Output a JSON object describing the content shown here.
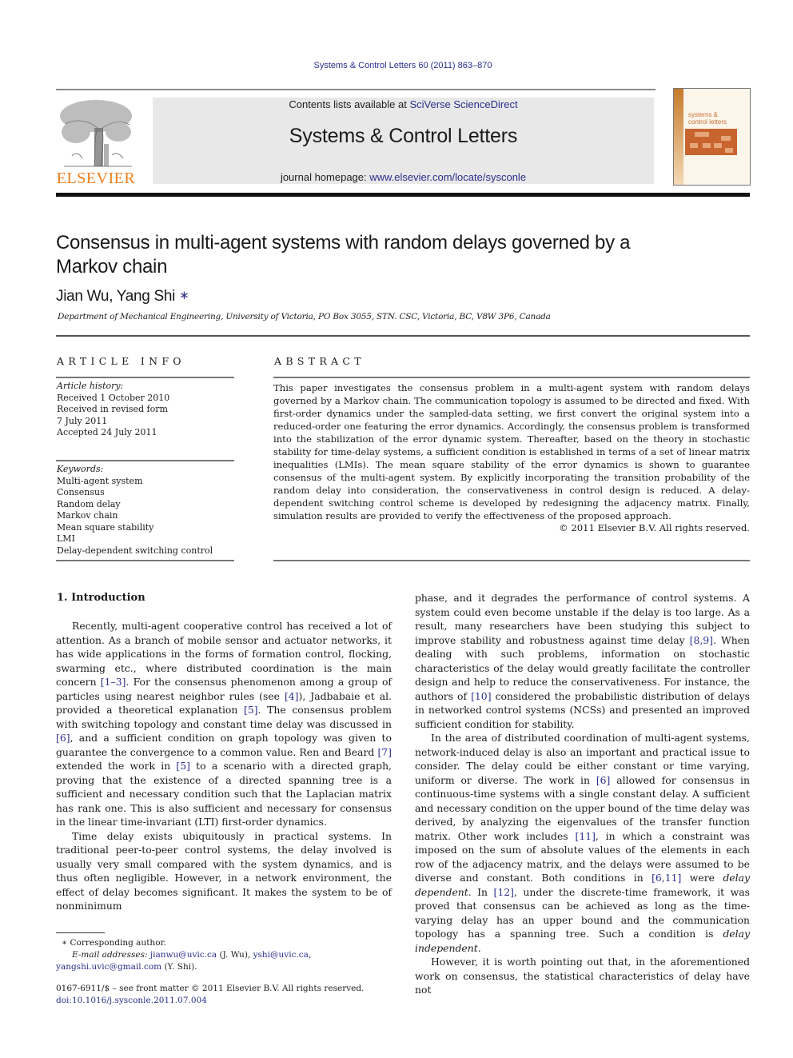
{
  "header": {
    "citation": "Systems & Control Letters 60 (2011) 863–870",
    "contents_prefix": "Contents lists available at ",
    "contents_link": "SciVerse ScienceDirect",
    "journal_name": "Systems & Control Letters",
    "homepage_prefix": "journal homepage: ",
    "homepage_link": "www.elsevier.com/locate/sysconle",
    "publisher_logo": "ELSEVIER",
    "cover_title_line1": "systems &",
    "cover_title_line2": "control letters",
    "colors": {
      "link": "#2b2f8c",
      "elsevier_orange": "#f07e1b",
      "banner_bg": "#e8e8e8"
    }
  },
  "article": {
    "title": "Consensus in multi-agent systems with random delays governed by a Markov chain",
    "authors": "Jian Wu, Yang Shi",
    "author_mark": "∗",
    "affiliation": "Department of Mechanical Engineering, University of Victoria, PO Box 3055, STN. CSC, Victoria, BC, V8W 3P6, Canada"
  },
  "article_info": {
    "heading": "ARTICLE INFO",
    "history_label": "Article history:",
    "history": [
      "Received 1 October 2010",
      "Received in revised form",
      "7 July 2011",
      "Accepted 24 July 2011"
    ],
    "keywords_label": "Keywords:",
    "keywords": [
      "Multi-agent system",
      "Consensus",
      "Random delay",
      "Markov chain",
      "Mean square stability",
      "LMI",
      "Delay-dependent switching control"
    ]
  },
  "abstract": {
    "heading": "ABSTRACT",
    "text": "This paper investigates the consensus problem in a multi-agent system with random delays governed by a Markov chain. The communication topology is assumed to be directed and fixed. With first-order dynamics under the sampled-data setting, we first convert the original system into a reduced-order one featuring the error dynamics. Accordingly, the consensus problem is transformed into the stabilization of the error dynamic system. Thereafter, based on the theory in stochastic stability for time-delay systems, a sufficient condition is established in terms of a set of linear matrix inequalities (LMIs). The mean square stability of the error dynamics is shown to guarantee consensus of the multi-agent system. By explicitly incorporating the transition probability of the random delay into consideration, the conservativeness in control design is reduced. A delay-dependent switching control scheme is developed by redesigning the adjacency matrix. Finally, simulation results are provided to verify the effectiveness of the proposed approach.",
    "copyright": "© 2011 Elsevier B.V. All rights reserved."
  },
  "introduction": {
    "heading": "1.  Introduction",
    "left_paragraphs": [
      [
        {
          "t": "Recently, multi-agent cooperative control has received a lot of attention. As a branch of mobile sensor and actuator networks, it has wide applications in the forms of formation control, flocking, swarming etc., where distributed coordination is the main concern "
        },
        {
          "ref": "[1–3]"
        },
        {
          "t": ". For the consensus phenomenon among a group of particles using nearest neighbor rules (see "
        },
        {
          "ref": "[4]"
        },
        {
          "t": "), Jadbabaie et al. provided a theoretical explanation "
        },
        {
          "ref": "[5]"
        },
        {
          "t": ". The consensus problem with switching topology and constant time delay was discussed in "
        },
        {
          "ref": "[6]"
        },
        {
          "t": ", and a sufficient condition on graph topology was given to guarantee the convergence to a common value. Ren and Beard "
        },
        {
          "ref": "[7]"
        },
        {
          "t": " extended the work in "
        },
        {
          "ref": "[5]"
        },
        {
          "t": " to a scenario with a directed graph, proving that the existence of a directed spanning tree is a sufficient and necessary condition such that the Laplacian matrix has rank one. This is also sufficient and necessary for consensus in the linear time-invariant (LTI) first-order dynamics."
        }
      ],
      [
        {
          "t": "Time delay exists ubiquitously in practical systems. In traditional peer-to-peer control systems, the delay involved is usually very small compared with the system dynamics, and is thus often negligible. However, in a network environment, the effect of delay becomes significant. It makes the system to be of nonminimum"
        }
      ]
    ],
    "right_paragraphs": [
      [
        {
          "t": "phase, and it degrades the performance of control systems. A system could even become unstable if the delay is too large. As a result, many researchers have been studying this subject to improve stability and robustness against time delay "
        },
        {
          "ref": "[8,9]"
        },
        {
          "t": ". When dealing with such problems, information on stochastic characteristics of the delay would greatly facilitate the controller design and help to reduce the conservativeness. For instance, the authors of "
        },
        {
          "ref": "[10]"
        },
        {
          "t": " considered the probabilistic distribution of delays in networked control systems (NCSs) and presented an improved sufficient condition for stability."
        }
      ],
      [
        {
          "t": "In the area of distributed coordination of multi-agent systems, network-induced delay is also an important and practical issue to consider. The delay could be either constant or time varying, uniform or diverse. The work in "
        },
        {
          "ref": "[6]"
        },
        {
          "t": " allowed for consensus in continuous-time systems with a single constant delay. A sufficient and necessary condition on the upper bound of the time delay was derived, by analyzing the eigenvalues of the transfer function matrix. Other work includes "
        },
        {
          "ref": "[11]"
        },
        {
          "t": ", in which a constraint was imposed on the sum of absolute values of the elements in each row of the adjacency matrix, and the delays were assumed to be diverse and constant. Both conditions in "
        },
        {
          "ref": "[6,11]"
        },
        {
          "t": " were "
        },
        {
          "em": "delay dependent"
        },
        {
          "t": ". In "
        },
        {
          "ref": "[12]"
        },
        {
          "t": ", under the discrete-time framework, it was proved that consensus can be achieved as long as the time-varying delay has an upper bound and the communication topology has a spanning tree. Such a condition is "
        },
        {
          "em": "delay independent"
        },
        {
          "t": "."
        }
      ],
      [
        {
          "t": "However, it is worth pointing out that, in the aforementioned work on consensus, the statistical characteristics of delay have not"
        }
      ]
    ]
  },
  "footnotes": {
    "mark": "∗",
    "corresponding": "Corresponding author.",
    "email_label": "E-mail addresses:",
    "email1": "jianwu@uvic.ca",
    "email1_owner": " (J. Wu), ",
    "email2": "yshi@uvic.ca",
    "email2_sep": ",",
    "email3": "yangshi.uvic@gmail.com",
    "email3_owner": " (Y. Shi).",
    "front_matter": "0167-6911/$ – see front matter © 2011 Elsevier B.V. All rights reserved.",
    "doi": "doi:10.1016/j.sysconle.2011.07.004"
  }
}
